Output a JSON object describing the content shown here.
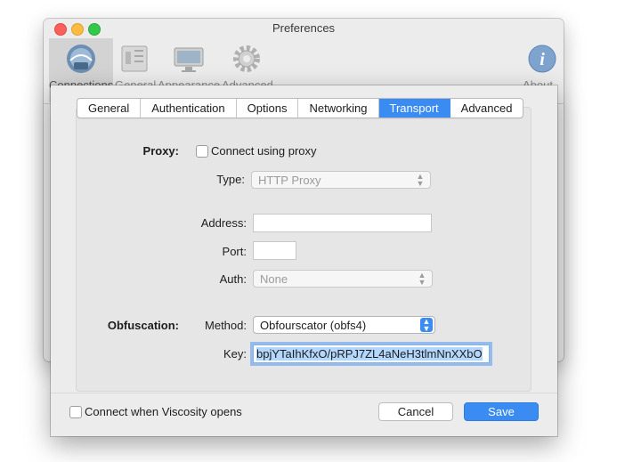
{
  "window": {
    "title": "Preferences",
    "toolbar": [
      {
        "label": "Connections",
        "icon": "connections-icon",
        "selected": true
      },
      {
        "label": "General",
        "icon": "general-icon"
      },
      {
        "label": "Appearance",
        "icon": "appearance-icon"
      },
      {
        "label": "Advanced",
        "icon": "gear-icon"
      },
      {
        "label": "About",
        "icon": "info-icon"
      }
    ]
  },
  "sheet": {
    "tabs": [
      "General",
      "Authentication",
      "Options",
      "Networking",
      "Transport",
      "Advanced"
    ],
    "active_tab": "Transport",
    "proxy": {
      "section_label": "Proxy:",
      "connect_checkbox_label": "Connect using proxy",
      "type_label": "Type:",
      "type_value": "HTTP Proxy",
      "address_label": "Address:",
      "address_value": "",
      "port_label": "Port:",
      "port_value": "",
      "auth_label": "Auth:",
      "auth_value": "None"
    },
    "obfuscation": {
      "section_label": "Obfuscation:",
      "method_label": "Method:",
      "method_value": "Obfourscator (obfs4)",
      "key_label": "Key:",
      "key_value": "bpjYTaIhKfxO/pRPJ7ZL4aNeH3tlmNnXXbO"
    },
    "footer": {
      "connect_on_open_label": "Connect when Viscosity opens",
      "cancel_label": "Cancel",
      "save_label": "Save"
    }
  },
  "colors": {
    "accent": "#3b8cf2",
    "close": "#fc605c",
    "minimize": "#fdbc40",
    "maximize": "#34c84a"
  }
}
